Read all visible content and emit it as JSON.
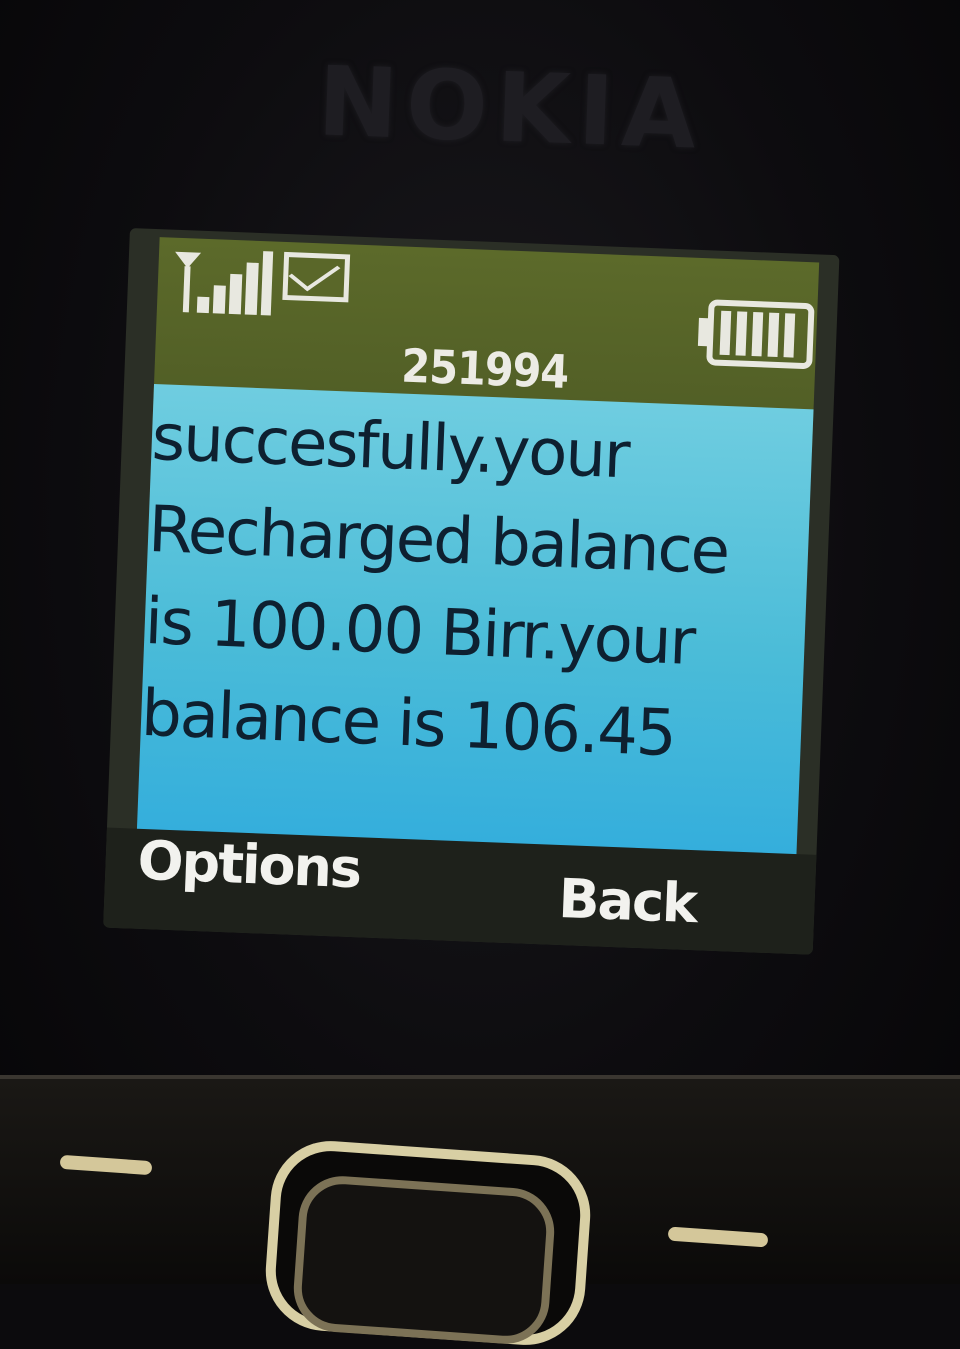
{
  "brand": "NOKIA",
  "status_bar": {
    "signal_icon": "signal-strength-icon",
    "message_icon": "envelope-icon",
    "battery_icon": "battery-icon"
  },
  "message": {
    "sender": "251994",
    "lines": [
      "succesfully.your",
      "Recharged balance",
      "is 100.00 Birr.your",
      "balance is 106.45"
    ]
  },
  "softkeys": {
    "left": "Options",
    "right": "Back"
  },
  "colors": {
    "status_bar": "#566326",
    "message_background": "#4bbcd8",
    "message_text": "#0e2030",
    "softkey_text": "#f2f2ee"
  }
}
